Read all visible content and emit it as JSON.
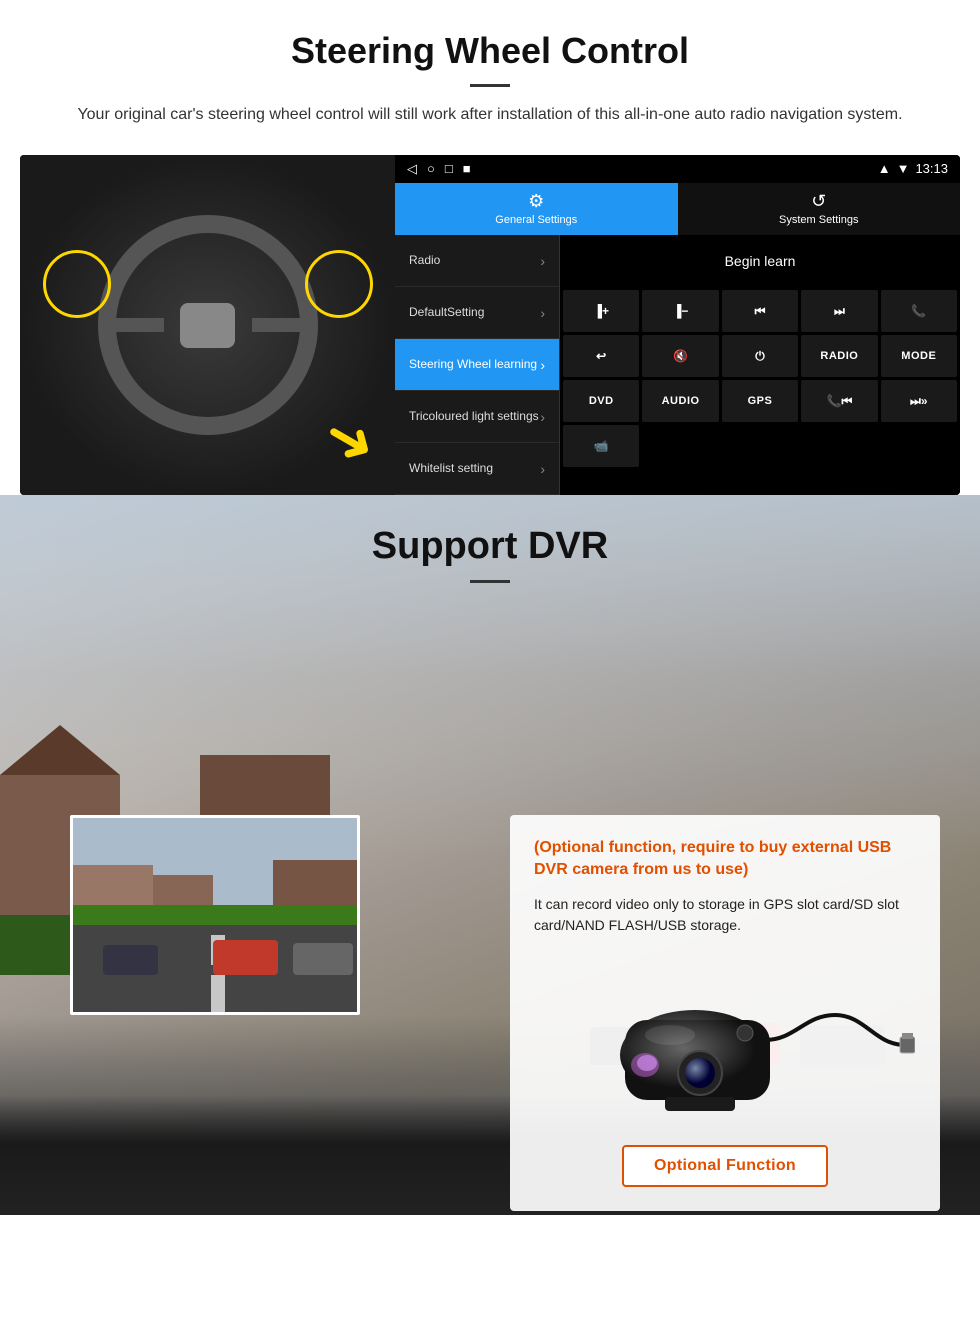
{
  "steering": {
    "title": "Steering Wheel Control",
    "description": "Your original car's steering wheel control will still work after installation of this all-in-one auto radio navigation system.",
    "android_ui": {
      "status_bar": {
        "icons": [
          "◁",
          "○",
          "□",
          "■"
        ],
        "time": "13:13",
        "wifi_icon": "▼",
        "signal_icon": "▲"
      },
      "tabs": [
        {
          "label": "General Settings",
          "active": true,
          "icon": "⚙"
        },
        {
          "label": "System Settings",
          "active": false,
          "icon": "🔄"
        }
      ],
      "menu_items": [
        {
          "label": "Radio",
          "active": false
        },
        {
          "label": "DefaultSetting",
          "active": false
        },
        {
          "label": "Steering Wheel learning",
          "active": true
        },
        {
          "label": "Tricoloured light settings",
          "active": false
        },
        {
          "label": "Whitelist setting",
          "active": false
        }
      ],
      "begin_learn": "Begin learn",
      "control_buttons": [
        {
          "symbol": "▐+",
          "row": 1
        },
        {
          "symbol": "▐-",
          "row": 1
        },
        {
          "symbol": "⏮",
          "row": 1
        },
        {
          "symbol": "⏭",
          "row": 1
        },
        {
          "symbol": "📞",
          "row": 1
        },
        {
          "symbol": "↩",
          "row": 2
        },
        {
          "symbol": "🔇",
          "row": 2
        },
        {
          "symbol": "⏻",
          "row": 2
        },
        {
          "symbol": "RADIO",
          "row": 2
        },
        {
          "symbol": "MODE",
          "row": 2
        },
        {
          "symbol": "DVD",
          "row": 3
        },
        {
          "symbol": "AUDIO",
          "row": 3
        },
        {
          "symbol": "GPS",
          "row": 3
        },
        {
          "symbol": "📞⏮",
          "row": 3
        },
        {
          "symbol": "⏭⏭",
          "row": 3
        },
        {
          "symbol": "📹",
          "row": 4
        }
      ]
    }
  },
  "dvr": {
    "title": "Support DVR",
    "optional_text": "(Optional function, require to buy external USB DVR camera from us to use)",
    "description": "It can record video only to storage in GPS slot card/SD slot card/NAND FLASH/USB storage.",
    "optional_button": "Optional Function"
  }
}
